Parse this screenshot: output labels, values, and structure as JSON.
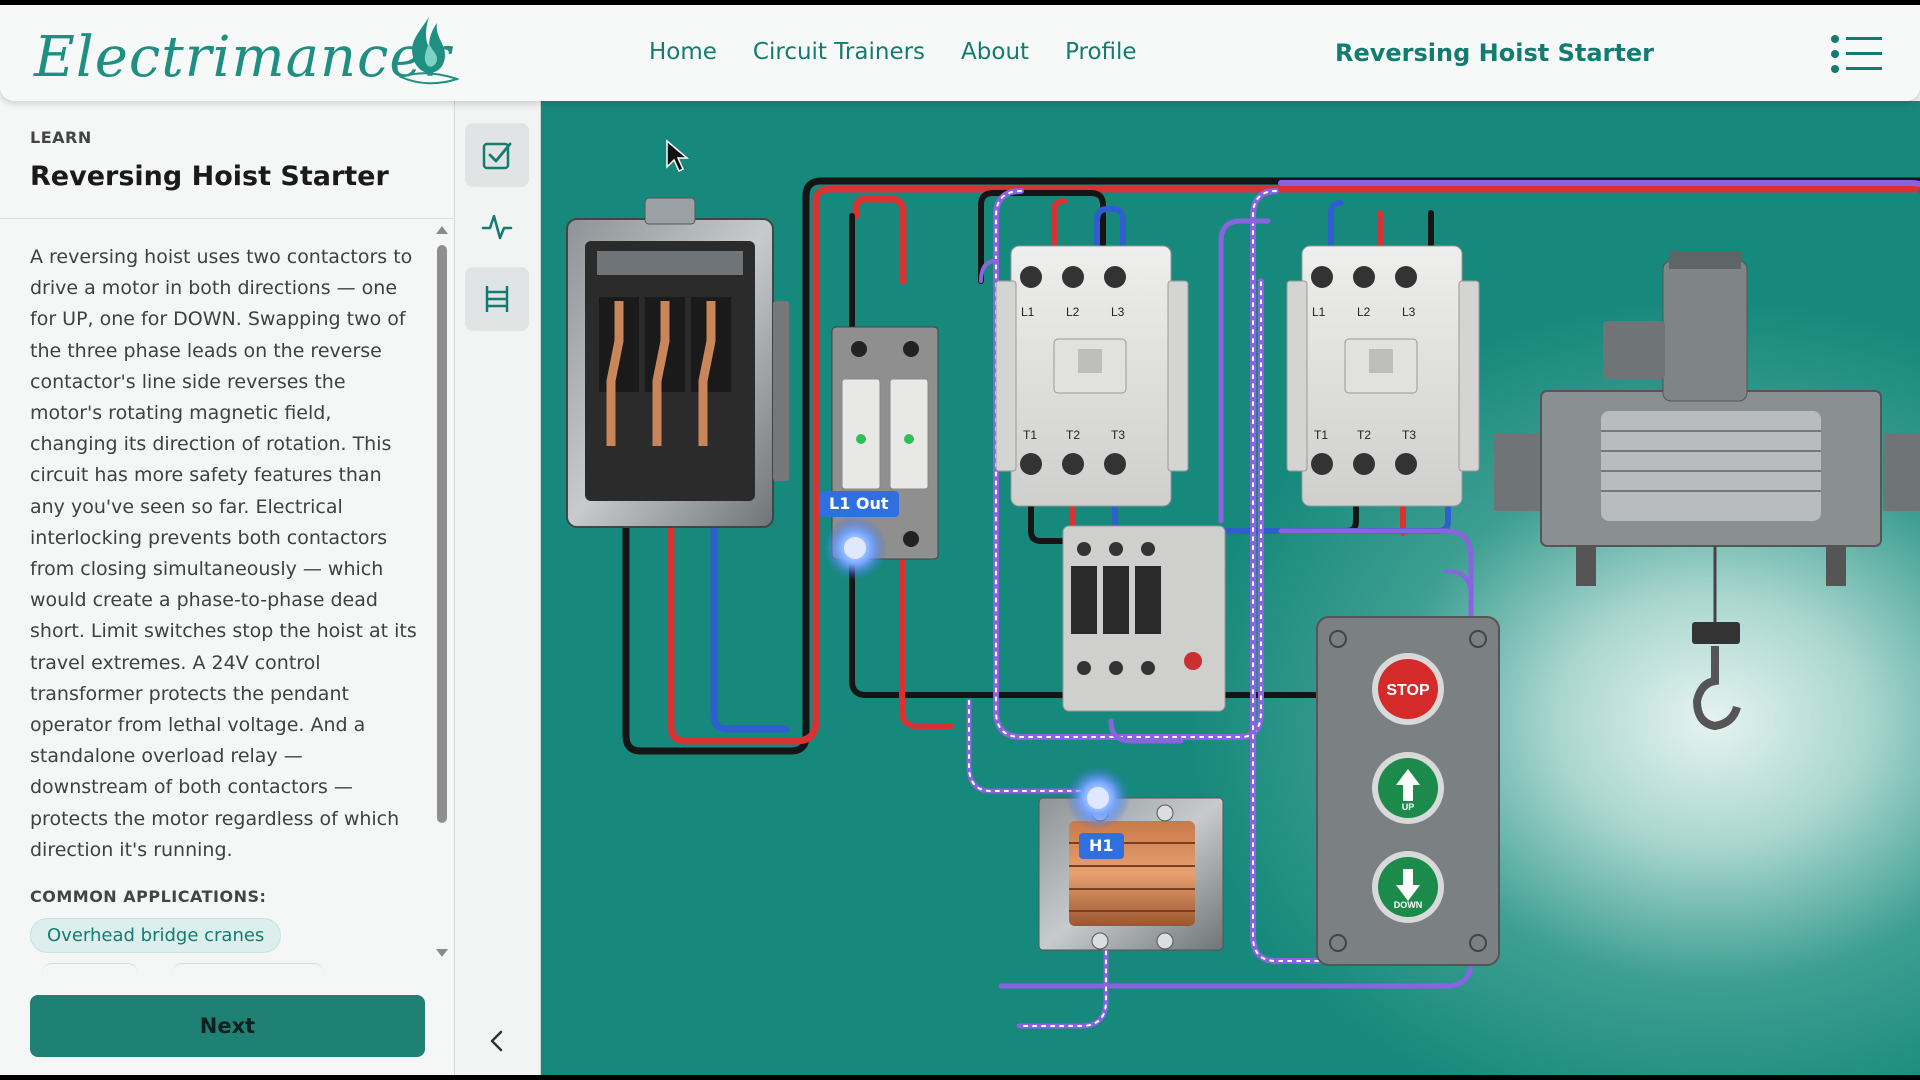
{
  "header": {
    "logo_text": "Electrimancer",
    "nav": [
      "Home",
      "Circuit Trainers",
      "About",
      "Profile"
    ],
    "page_title": "Reversing Hoist Starter"
  },
  "lesson": {
    "section_label": "LEARN",
    "title": "Reversing Hoist Starter",
    "description": "A reversing hoist uses two contactors to drive a motor in both directions — one for UP, one for DOWN. Swapping two of the three phase leads on the reverse contactor's line side reverses the motor's rotating magnetic field, changing its direction of rotation. This circuit has more safety features than any you've seen so far. Electrical interlocking prevents both contactors from closing simultaneously — which would create a phase-to-phase dead short. Limit switches stop the hoist at its travel extremes. A 24V control transformer protects the pendant operator from lethal voltage. And a standalone overload relay — downstream of both contactors — protects the motor regardless of which direction it's running.",
    "applications_label": "COMMON APPLICATIONS:",
    "applications": [
      "Overhead bridge cranes"
    ],
    "next_label": "Next"
  },
  "tools": [
    "checklist-icon",
    "waveform-icon",
    "ladder-diagram-icon",
    "collapse-chevron-icon"
  ],
  "diagram": {
    "contactor_terminals_line": [
      "L1",
      "L2",
      "L3"
    ],
    "contactor_terminals_load": [
      "T1",
      "T2",
      "T3"
    ],
    "terminal_tag_top": "L1 Out",
    "terminal_tag_transformer": "H1",
    "pendant_buttons": [
      "STOP",
      "UP",
      "DOWN"
    ]
  },
  "colors": {
    "brand": "#137c70",
    "button": "#1e8174",
    "wire_red": "#d83333",
    "wire_blue": "#2f5fcf",
    "wire_black": "#151515",
    "wire_purple": "#8a63e0",
    "tag_blue": "#2f6fe0"
  }
}
